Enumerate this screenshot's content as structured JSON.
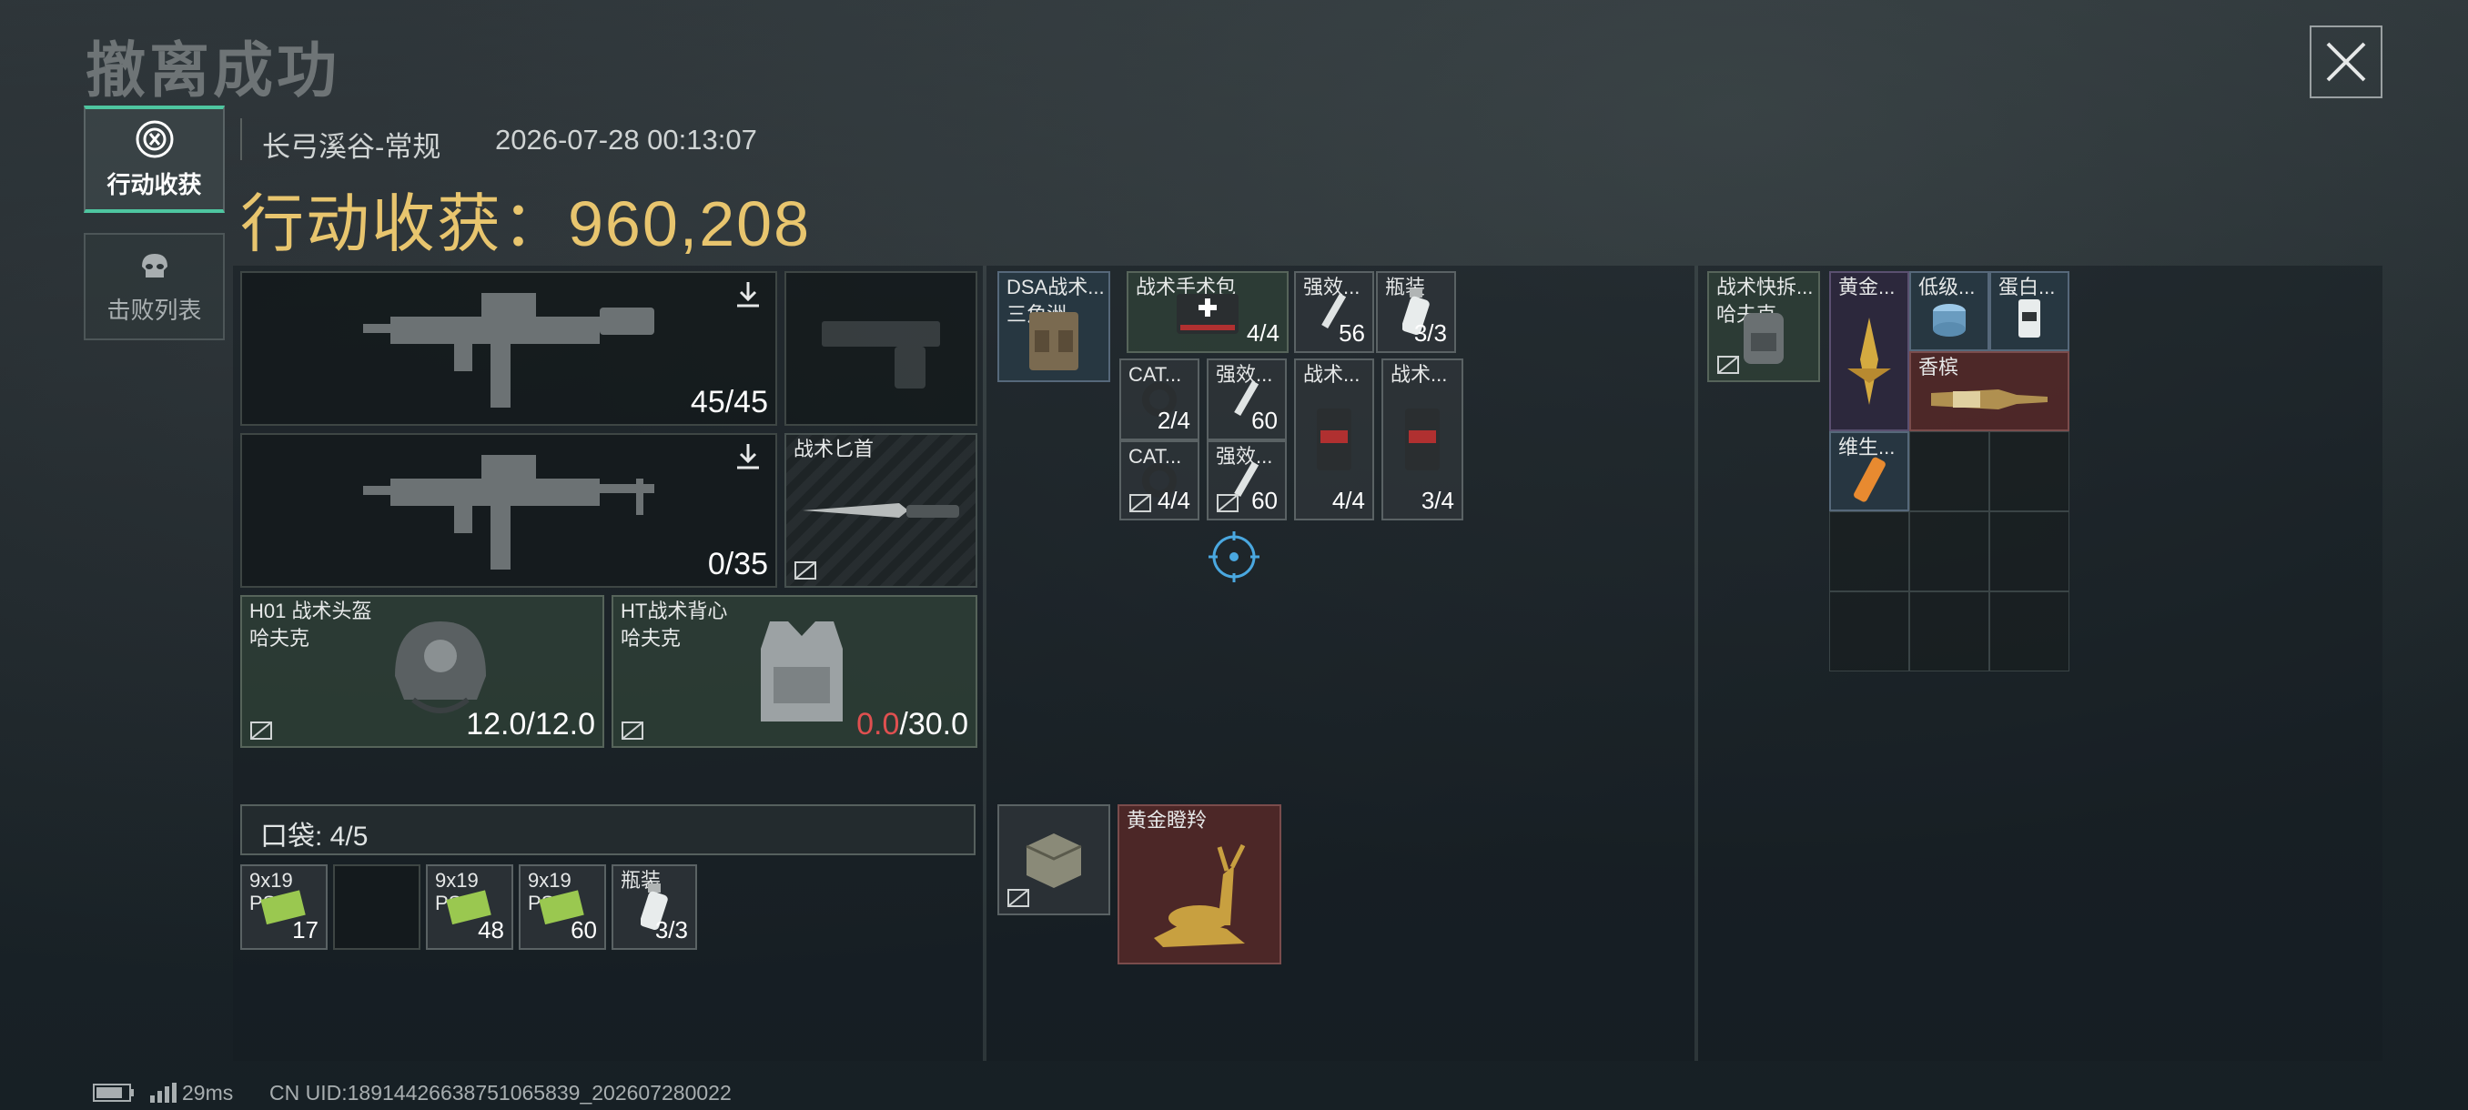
{
  "header": {
    "title": "撤离成功",
    "map": "长弓溪谷-常规",
    "datetime": "2026-07-28 00:13:07",
    "loot_label": "行动收获：",
    "loot_value": "960,208"
  },
  "tabs": [
    {
      "label": "行动收获",
      "active": true,
      "icon": "emblem-icon"
    },
    {
      "label": "击败列表",
      "active": false,
      "icon": "skull-icon"
    }
  ],
  "loadout": {
    "primary1_ammo": "45/45",
    "primary2_ammo": "0/35",
    "melee_name": "战术匕首",
    "helmet_name": "H01 战术头盔",
    "helmet_brand": "哈夫克",
    "helmet_dur": "12.0/12.0",
    "armor_name": "HT战术背心",
    "armor_brand": "哈夫克",
    "armor_dur_cur": "0.0",
    "armor_dur_max": "/30.0"
  },
  "pocket": {
    "label": "口袋:  4/5",
    "items": [
      {
        "l1": "9x19",
        "l2": "PSO",
        "count": "17"
      },
      {
        "l1": "",
        "l2": "",
        "count": ""
      },
      {
        "l1": "9x19",
        "l2": "PSO",
        "count": "48"
      },
      {
        "l1": "9x19",
        "l2": "PSO",
        "count": "60"
      },
      {
        "l1": "瓶装",
        "l2": "",
        "count": "3/3"
      }
    ]
  },
  "rig": {
    "name": "DSA战术...",
    "brand": "三角洲",
    "items": [
      {
        "label": "战术手术包",
        "count": "4/4"
      },
      {
        "label": "强效...",
        "count": "56"
      },
      {
        "label": "瓶装",
        "count": "3/3"
      },
      {
        "label": "CAT...",
        "count": "2/4"
      },
      {
        "label": "强效...",
        "count": "60"
      },
      {
        "label": "战术...",
        "count": "4/4"
      },
      {
        "label": "战术...",
        "count": "3/4"
      },
      {
        "label": "CAT...",
        "count": "4/4"
      },
      {
        "label": "强效...",
        "count": "60"
      }
    ]
  },
  "secure": {
    "item_label": "黄金瞪羚"
  },
  "backpack": {
    "name": "战术快拆...",
    "brand": "哈夫克",
    "items": [
      {
        "label": "黄金..."
      },
      {
        "label": "低级..."
      },
      {
        "label": "蛋白..."
      },
      {
        "label": "香槟"
      },
      {
        "label": "维生..."
      }
    ]
  },
  "footer": {
    "ping": "29ms",
    "uid": "CN UID:18914426638751065839_202607280022"
  },
  "colors": {
    "accent": "#e8c56e",
    "tab_active": "#4ec6a0",
    "warning": "#e05050"
  }
}
